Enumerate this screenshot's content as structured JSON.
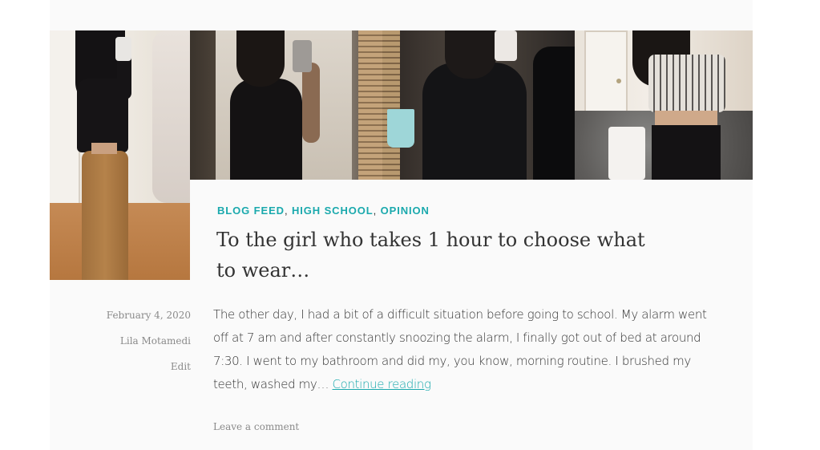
{
  "post": {
    "categories": [
      {
        "label": "BLOG FEED"
      },
      {
        "label": "HIGH SCHOOL"
      },
      {
        "label": "OPINION"
      }
    ],
    "category_separator": ",",
    "title": "To the girl who takes 1 hour to choose what to wear…",
    "date": "February 4, 2020",
    "author": "Lila Motamedi",
    "edit_label": "Edit",
    "excerpt": "The other day, I had a bit of a difficult situation before going to school. My alarm went off at 7 am and after constantly snoozing the alarm, I finally got out of bed at around 7:30. I went to my bathroom and did my, you know, morning routine. I brushed my teeth, washed my… ",
    "continue_label": "Continue reading",
    "comment_label": "Leave a comment"
  },
  "colors": {
    "accent": "#1aa9ad",
    "text": "#333333",
    "meta": "#8a8a8a",
    "card_background": "#fafafa"
  }
}
